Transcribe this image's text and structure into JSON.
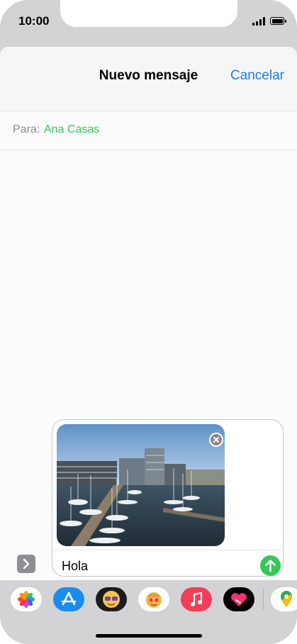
{
  "status_bar": {
    "time": "10:00"
  },
  "nav": {
    "title": "Nuevo mensaje",
    "cancel_label": "Cancelar"
  },
  "recipient": {
    "label": "Para:",
    "name": "Ana Casas"
  },
  "composer": {
    "attachment_icon": "harbor-photo",
    "message_text": "Hola"
  },
  "app_drawer": {
    "apps": [
      "photos-app-icon",
      "app-store-app-icon",
      "memoji-app-icon",
      "memoji-stickers-app-icon",
      "music-app-icon",
      "digital-touch-app-icon",
      "maps-app-icon"
    ]
  },
  "colors": {
    "accent_blue": "#1a7cf5",
    "recipient_green": "#34c759",
    "send_green": "#34c759"
  }
}
